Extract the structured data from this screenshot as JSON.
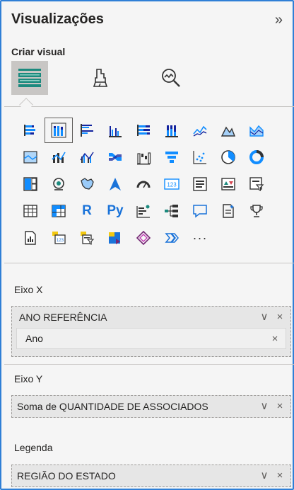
{
  "pane": {
    "title": "Visualizações",
    "collapse_glyph": "»",
    "section_title": "Criar visual"
  },
  "mode_tabs": [
    {
      "name": "build-visual",
      "icon": "build-visual-icon",
      "active": true
    },
    {
      "name": "format-visual",
      "icon": "format-paint-icon",
      "active": false
    },
    {
      "name": "analytics",
      "icon": "analytics-magnifier-icon",
      "active": false
    }
  ],
  "gallery": {
    "row1": [
      "stacked-bar-chart-icon",
      "stacked-column-chart-icon",
      "clustered-bar-chart-icon",
      "clustered-column-chart-icon",
      "100-stacked-bar-chart-icon",
      "100-stacked-column-chart-icon",
      "line-chart-icon",
      "area-chart-icon",
      "stacked-area-chart-icon"
    ],
    "row2": [
      "100-stacked-area-chart-icon",
      "line-and-stacked-column-icon",
      "line-and-clustered-column-icon",
      "ribbon-chart-icon",
      "waterfall-chart-icon",
      "funnel-chart-icon",
      "scatter-chart-icon",
      "pie-chart-icon",
      "donut-chart-icon"
    ],
    "row3": [
      "treemap-icon",
      "map-icon",
      "filled-map-icon",
      "azure-map-icon",
      "gauge-icon",
      "card-icon",
      "multi-row-card-icon",
      "kpi-icon",
      "slicer-icon"
    ],
    "row4": [
      "table-icon",
      "matrix-icon",
      "r-visual-icon",
      "python-visual-icon",
      "key-influencers-icon",
      "decomposition-tree-icon",
      "qa-icon",
      "smart-narrative-icon",
      "metrics-icon"
    ],
    "row5": [
      "paginated-report-icon",
      "custom-card-icon",
      "custom-slicer-icon",
      "power-apps-icon",
      "power-automate-icon",
      "chevron-flow-icon",
      "more-visuals-icon"
    ],
    "text_glyphs": {
      "r": "R",
      "py": "Py",
      "card": "123",
      "more": "···"
    }
  },
  "wells": {
    "x_axis": {
      "label": "Eixo X",
      "field": "ANO REFERÊNCIA",
      "sub_field": "Ano"
    },
    "y_axis": {
      "label": "Eixo Y",
      "field": "Soma de QUANTIDADE DE ASSOCIADOS"
    },
    "legend": {
      "label": "Legenda",
      "field": "REGIÃO DO ESTADO"
    }
  },
  "glyphs": {
    "chevron": "∨",
    "close": "×"
  },
  "colors": {
    "accent": "#2f7fd6",
    "teal": "#1c8a7e",
    "chart_blue": "#118dff",
    "chart_dark": "#12239e",
    "active_tab": "#c8c6c4"
  }
}
